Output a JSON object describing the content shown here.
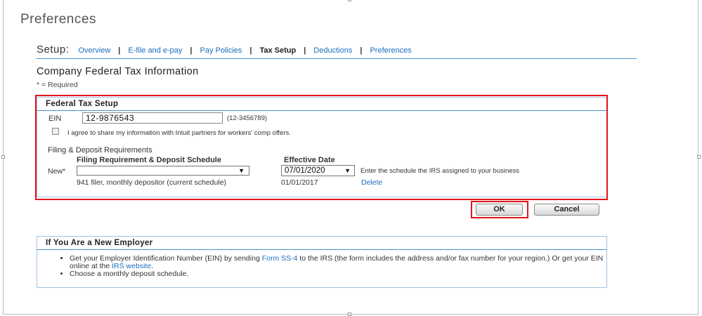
{
  "page_title": "Preferences",
  "setup_nav": {
    "label": "Setup:",
    "items": [
      {
        "label": "Overview",
        "current": false
      },
      {
        "label": "E-file and e-pay",
        "current": false
      },
      {
        "label": "Pay Policies",
        "current": false
      },
      {
        "label": "Tax Setup",
        "current": true
      },
      {
        "label": "Deductions",
        "current": false
      },
      {
        "label": "Preferences",
        "current": false
      }
    ],
    "separator": "|"
  },
  "section_title": "Company Federal Tax Information",
  "required_note": "* = Required",
  "federal_panel": {
    "title": "Federal Tax Setup",
    "ein_label": "EIN",
    "ein_value": "12-9876543",
    "ein_hint": "(12-3456789)",
    "agree_text": "I agree to share my information with Intuit partners for workers' comp offers.",
    "agree_checked": false,
    "filing_title": "Filing & Deposit Requirements",
    "col_schedule": "Filing Requirement & Deposit Schedule",
    "col_date": "Effective Date",
    "new_label": "New*",
    "new_schedule_value": "",
    "new_date_value": "07/01/2020",
    "schedule_hint": "Enter the schedule the IRS assigned to your business",
    "current_schedule": "941 filer, monthly depositor (current schedule)",
    "current_date": "01/01/2017",
    "delete_label": "Delete"
  },
  "buttons": {
    "ok": "OK",
    "cancel": "Cancel"
  },
  "employer_panel": {
    "title": "If You Are a New Employer",
    "bullet1_part1": "Get your Employer Identification Number (EIN) by sending ",
    "bullet1_link1": "Form SS-4",
    "bullet1_part2": " to the IRS (the form includes the address and/or fax number for your region.) Or get your EIN online at the ",
    "bullet1_link2": "IRS website",
    "bullet1_part3": ".",
    "bullet2": "Choose a monthly deposit schedule."
  },
  "colors": {
    "link": "#1a6fc1",
    "highlight": "#e3151a",
    "panel_border": "#9ec3e6"
  }
}
